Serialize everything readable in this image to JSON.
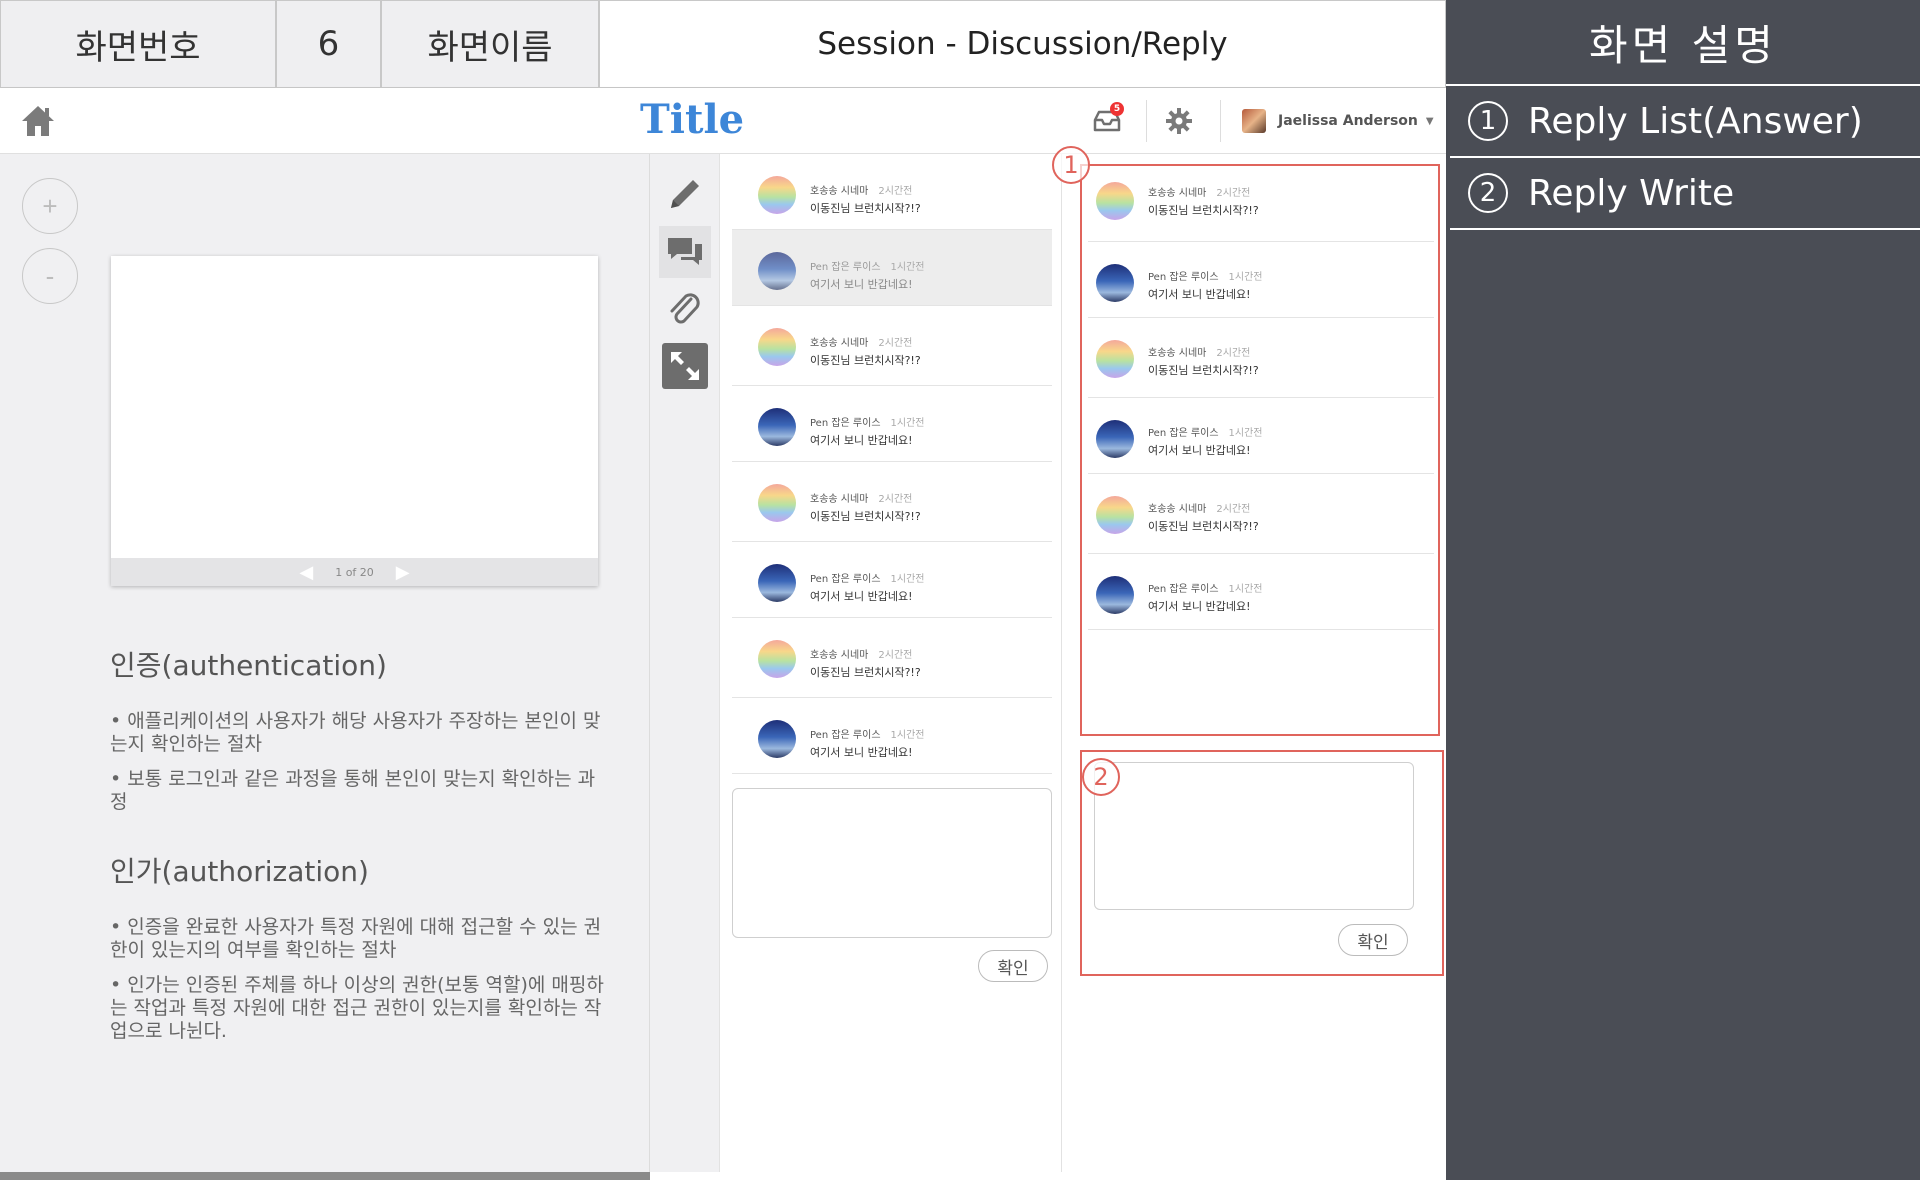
{
  "spec": {
    "screen_no_label": "화면번호",
    "screen_no": "6",
    "screen_name_label": "화면이름",
    "screen_name": "Session - Discussion/Reply"
  },
  "description": {
    "title": "화면 설명",
    "items": [
      {
        "num": "1",
        "label": "Reply List(Answer)"
      },
      {
        "num": "2",
        "label": "Reply Write"
      }
    ]
  },
  "app": {
    "title": "Title",
    "notification_count": "5",
    "user_name": "Jaelissa Anderson"
  },
  "viewer": {
    "zoom_in": "+",
    "zoom_out": "-",
    "page_indicator": "1 of 20",
    "heading1": "인증(authentication)",
    "para1": "• 애플리케이션의 사용자가 해당 사용자가 주장하는 본인이 맞는지 확인하는 절차",
    "para2": "• 보통 로그인과 같은 과정을 통해 본인이 맞는지 확인하는 과정",
    "heading2": "인가(authorization)",
    "para3": "• 인증을 완료한 사용자가 특정 자원에 대해 접근할 수 있는 권한이 있는지의 여부를 확인하는 절차",
    "para4": "• 인가는 인증된 주체를 하나 이상의 권한(보통 역할)에 매핑하는 작업과 특정 자원에 대한 접근 권한이 있는지를 확인하는 작업으로 나뉜다."
  },
  "discussion": {
    "messages": [
      {
        "author": "호송송 시네마",
        "time": "2시간전",
        "text": "이동진님 브런치시작?!?",
        "avatar": "rainbow"
      },
      {
        "author": "Pen 잡은 루이스",
        "time": "1시간전",
        "text": "여기서 보니 반갑네요!",
        "avatar": "sky"
      },
      {
        "author": "호송송 시네마",
        "time": "2시간전",
        "text": "이동진님 브런치시작?!?",
        "avatar": "rainbow"
      },
      {
        "author": "Pen 잡은 루이스",
        "time": "1시간전",
        "text": "여기서 보니 반갑네요!",
        "avatar": "sky"
      },
      {
        "author": "호송송 시네마",
        "time": "2시간전",
        "text": "이동진님 브런치시작?!?",
        "avatar": "rainbow"
      },
      {
        "author": "Pen 잡은 루이스",
        "time": "1시간전",
        "text": "여기서 보니 반갑네요!",
        "avatar": "sky"
      },
      {
        "author": "호송송 시네마",
        "time": "2시간전",
        "text": "이동진님 브런치시작?!?",
        "avatar": "rainbow"
      },
      {
        "author": "Pen 잡은 루이스",
        "time": "1시간전",
        "text": "여기서 보니 반갑네요!",
        "avatar": "sky"
      }
    ],
    "confirm_label": "확인"
  },
  "replies": {
    "items": [
      {
        "author": "호송송 시네마",
        "time": "2시간전",
        "text": "이동진님 브런치시작?!?",
        "avatar": "rainbow"
      },
      {
        "author": "Pen 잡은 루이스",
        "time": "1시간전",
        "text": "여기서 보니 반갑네요!",
        "avatar": "sky"
      },
      {
        "author": "호송송 시네마",
        "time": "2시간전",
        "text": "이동진님 브런치시작?!?",
        "avatar": "rainbow"
      },
      {
        "author": "Pen 잡은 루이스",
        "time": "1시간전",
        "text": "여기서 보니 반갑네요!",
        "avatar": "sky"
      },
      {
        "author": "호송송 시네마",
        "time": "2시간전",
        "text": "이동진님 브런치시작?!?",
        "avatar": "rainbow"
      },
      {
        "author": "Pen 잡은 루이스",
        "time": "1시간전",
        "text": "여기서 보니 반갑네요!",
        "avatar": "sky"
      }
    ],
    "confirm_label": "확인",
    "marker1": "1",
    "marker2": "2"
  },
  "colors": {
    "accent_title": "#3d86d8",
    "annotation_red": "#e0645c",
    "desc_panel": "#4a4d55",
    "badge_red": "#ee3333"
  },
  "icons": {
    "home": "home-icon",
    "inbox": "inbox-icon",
    "settings": "gear-icon",
    "tools": [
      "pencil-icon",
      "chat-icon",
      "paperclip-icon",
      "expand-icon"
    ]
  }
}
